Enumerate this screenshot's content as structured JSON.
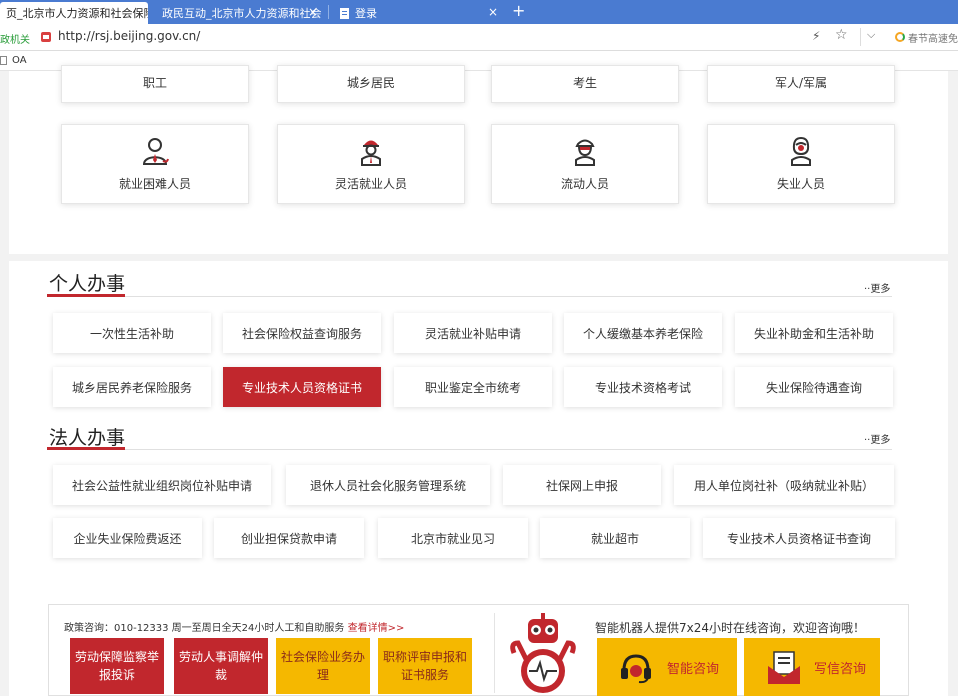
{
  "browser": {
    "tabs": [
      {
        "label": "页_北京市人力资源和社会保险"
      },
      {
        "label": "政民互动_北京市人力资源和社会"
      },
      {
        "label": "登录"
      }
    ],
    "new_tab": "+",
    "tab_close": "×",
    "address_prefix": "政机关",
    "url": "http://rsj.beijing.gov.cn/",
    "search_hint": "春节高速免",
    "bookmark": "OA"
  },
  "groups_top": [
    "职工",
    "城乡居民",
    "考生",
    "军人/军属"
  ],
  "groups": [
    {
      "label": "就业困难人员",
      "icon": "person-headset-icon"
    },
    {
      "label": "灵活就业人员",
      "icon": "worker-helmet-icon"
    },
    {
      "label": "流动人员",
      "icon": "person-cap-icon"
    },
    {
      "label": "失业人员",
      "icon": "person-woman-icon"
    }
  ],
  "personal": {
    "title": "个人办事",
    "more": "··更多",
    "row1": [
      "一次性生活补助",
      "社会保险权益查询服务",
      "灵活就业补贴申请",
      "个人缓缴基本养老保险",
      "失业补助金和生活补助"
    ],
    "row2": [
      "城乡居民养老保险服务",
      "专业技术人员资格证书",
      "职业鉴定全市统考",
      "专业技术资格考试",
      "失业保险待遇查询"
    ]
  },
  "legal": {
    "title": "法人办事",
    "more": "··更多",
    "row1": [
      "社会公益性就业组织岗位补贴申请",
      "退休人员社会化服务管理系统",
      "社保网上申报",
      "用人单位岗社补（吸纳就业补贴）"
    ],
    "row2": [
      "企业失业保险费返还",
      "创业担保贷款申请",
      "北京市就业见习",
      "就业超市",
      "专业技术人员资格证书查询"
    ]
  },
  "bottom": {
    "policy_text": "政策咨询：010-12333   周一至周日全天24小时人工和自助服务",
    "policy_detail": "查看详情>>",
    "buttons": [
      "劳动保障监察举报投诉",
      "劳动人事调解仲裁",
      "社会保险业务办理",
      "职称评审申报和证书服务"
    ],
    "robot_text": "智能机器人提供7x24小时在线咨询，欢迎咨询哦！",
    "robot_buttons": [
      "智能咨询",
      "写信咨询"
    ]
  },
  "colors": {
    "brand_red": "#c1272d",
    "accent_yellow": "#f5b800",
    "tab_blue": "#4a7bd1"
  }
}
